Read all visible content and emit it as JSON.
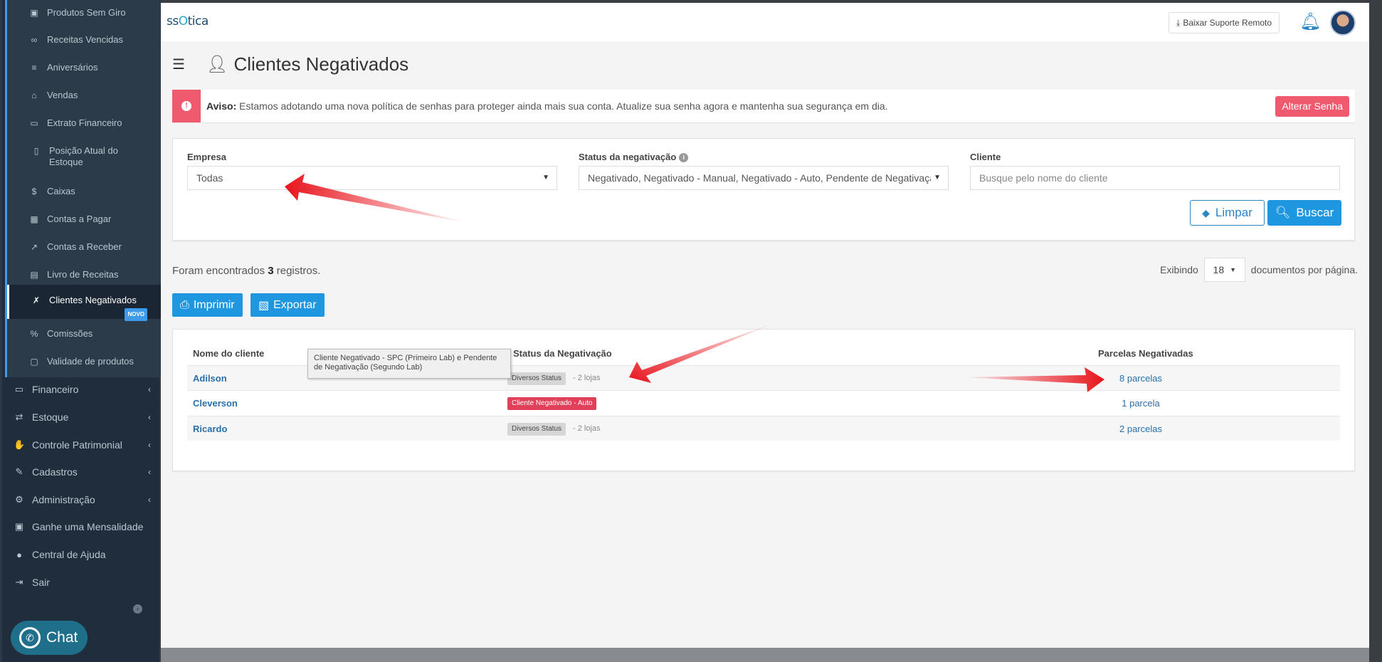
{
  "sidebar": {
    "sub_items": [
      {
        "label": "Produtos Sem Giro",
        "icon": "box-icon"
      },
      {
        "label": "Receitas Vencidas",
        "icon": "glasses-icon"
      },
      {
        "label": "Aniversários",
        "icon": "cake-icon"
      },
      {
        "label": "Vendas",
        "icon": "cart-icon"
      },
      {
        "label": "Extrato Financeiro",
        "icon": "money-icon"
      },
      {
        "label": "Posição Atual do Estoque",
        "icon": "file-icon"
      },
      {
        "label": "Caixas",
        "icon": "dollar-icon"
      },
      {
        "label": "Contas a Pagar",
        "icon": "calculator-icon"
      },
      {
        "label": "Contas a Receber",
        "icon": "chart-line-icon"
      },
      {
        "label": "Livro de Receitas",
        "icon": "book-icon"
      },
      {
        "label": "Clientes Negativados",
        "icon": "user-x-icon",
        "badge": "NOVO"
      },
      {
        "label": "Comissões",
        "icon": "percent-icon"
      },
      {
        "label": "Validade de produtos",
        "icon": "calendar-icon"
      }
    ],
    "main_items": [
      {
        "label": "Financeiro",
        "icon": "money-icon"
      },
      {
        "label": "Estoque",
        "icon": "exchange-icon"
      },
      {
        "label": "Controle Patrimonial",
        "icon": "hand-icon"
      },
      {
        "label": "Cadastros",
        "icon": "edit-icon"
      },
      {
        "label": "Administração",
        "icon": "gears-icon"
      },
      {
        "label": "Ganhe uma Mensalidade",
        "icon": "gift-icon"
      },
      {
        "label": "Central de Ajuda",
        "icon": "question-icon"
      },
      {
        "label": "Sair",
        "icon": "sign-out-icon"
      }
    ],
    "chat_label": "Chat"
  },
  "topbar": {
    "logo_text_1": "ss",
    "logo_text_2": "O",
    "logo_text_3": "tica",
    "download_label": "Baixar Suporte Remoto"
  },
  "page": {
    "title": "Clientes Negativados"
  },
  "alert": {
    "strong": "Aviso:",
    "text": " Estamos adotando uma nova política de senhas para proteger ainda mais sua conta. Atualize sua senha agora e mantenha sua segurança em dia.",
    "button": "Alterar Senha"
  },
  "filters": {
    "empresa_label": "Empresa",
    "empresa_value": "Todas",
    "status_label": "Status da negativação",
    "status_value": "Negativado, Negativado - Manual, Negativado - Auto, Pendente de Negativação",
    "cliente_label": "Cliente",
    "cliente_placeholder": "Busque pelo nome do cliente",
    "limpar": "Limpar",
    "buscar": "Buscar"
  },
  "results": {
    "prefix": "Foram encontrados ",
    "count": "3",
    "suffix": " registros.",
    "showing": "Exibindo",
    "per_page": "18",
    "per_page_suffix": "documentos por página."
  },
  "actions": {
    "print": "Imprimir",
    "export": "Exportar"
  },
  "table": {
    "headers": [
      "Nome do cliente",
      "Status da Negativação",
      "Parcelas Negativadas"
    ],
    "rows": [
      {
        "name": "Adilson",
        "status": "Diversos Status",
        "lojas": "- 2 lojas",
        "parcelas": "8 parcelas"
      },
      {
        "name": "Cleverson",
        "status": "Cliente Negativado - Auto",
        "lojas": "",
        "parcelas": "1 parcela"
      },
      {
        "name": "Ricardo",
        "status": "Diversos Status",
        "lojas": "- 2 lojas",
        "parcelas": "2 parcelas"
      }
    ],
    "tooltip": "Cliente Negativado - SPC (Primeiro Lab) e Pendente de Negativação (Segundo Lab)"
  },
  "colors": {
    "sidebar": "#1f2d3d",
    "accent": "#1e96e0",
    "danger": "#ef5a6f",
    "annotation_arrow": "#e8141c"
  }
}
